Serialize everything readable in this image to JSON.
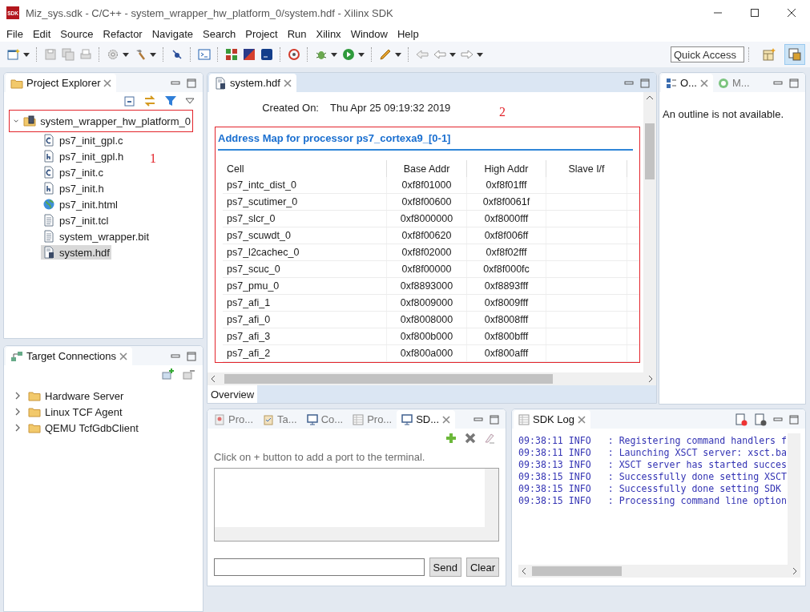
{
  "window": {
    "title": "Miz_sys.sdk - C/C++ - system_wrapper_hw_platform_0/system.hdf - Xilinx SDK",
    "app_icon_text": "SDK"
  },
  "menu": [
    "File",
    "Edit",
    "Source",
    "Refactor",
    "Navigate",
    "Search",
    "Project",
    "Run",
    "Xilinx",
    "Window",
    "Help"
  ],
  "quick_access": {
    "placeholder": "Quick Access"
  },
  "perspectives": [
    {
      "kind": "open",
      "selected": false
    },
    {
      "kind": "c",
      "selected": true
    }
  ],
  "project_explorer": {
    "tab": "Project Explorer",
    "annotation": "1",
    "tree": [
      {
        "label": "system_wrapper_hw_platform_0",
        "kind": "project",
        "expanded": true,
        "annotated": true,
        "selected": false,
        "children": [
          {
            "label": "ps7_init_gpl.c",
            "kind": "c",
            "selected": false
          },
          {
            "label": "ps7_init_gpl.h",
            "kind": "h",
            "selected": false
          },
          {
            "label": "ps7_init.c",
            "kind": "c",
            "selected": false
          },
          {
            "label": "ps7_init.h",
            "kind": "h",
            "selected": false
          },
          {
            "label": "ps7_init.html",
            "kind": "html",
            "selected": false
          },
          {
            "label": "ps7_init.tcl",
            "kind": "text",
            "selected": false
          },
          {
            "label": "system_wrapper.bit",
            "kind": "text",
            "selected": false
          },
          {
            "label": "system.hdf",
            "kind": "hdf",
            "selected": true
          }
        ]
      }
    ]
  },
  "target_connections": {
    "tab": "Target Connections",
    "tree": [
      {
        "label": "Hardware Server",
        "expanded": false
      },
      {
        "label": "Linux TCF Agent",
        "expanded": false
      },
      {
        "label": "QEMU TcfGdbClient",
        "expanded": false
      }
    ]
  },
  "editor": {
    "tab": "system.hdf",
    "created_on": {
      "label": "Created On:",
      "value": "Thu Apr 25 09:19:32 2019"
    },
    "annotation": "2",
    "address_map": {
      "title": "Address Map for processor ps7_cortexa9_[0-1]",
      "annotated": true,
      "columns": [
        "Cell",
        "Base Addr",
        "High Addr",
        "Slave I/f"
      ],
      "rows": [
        [
          "ps7_intc_dist_0",
          "0xf8f01000",
          "0xf8f01fff"
        ],
        [
          "ps7_scutimer_0",
          "0xf8f00600",
          "0xf8f0061f"
        ],
        [
          "ps7_slcr_0",
          "0xf8000000",
          "0xf8000fff"
        ],
        [
          "ps7_scuwdt_0",
          "0xf8f00620",
          "0xf8f006ff"
        ],
        [
          "ps7_l2cachec_0",
          "0xf8f02000",
          "0xf8f02fff"
        ],
        [
          "ps7_scuc_0",
          "0xf8f00000",
          "0xf8f000fc"
        ],
        [
          "ps7_pmu_0",
          "0xf8893000",
          "0xf8893fff"
        ],
        [
          "ps7_afi_1",
          "0xf8009000",
          "0xf8009fff"
        ],
        [
          "ps7_afi_0",
          "0xf8008000",
          "0xf8008fff"
        ],
        [
          "ps7_afi_3",
          "0xf800b000",
          "0xf800bfff"
        ],
        [
          "ps7_afi_2",
          "0xf800a000",
          "0xf800afff"
        ]
      ]
    },
    "page_tabs": [
      {
        "label": "Overview",
        "selected": true
      }
    ]
  },
  "outline": {
    "tabs": [
      {
        "label": "O...",
        "kind": "outline",
        "selected": true
      },
      {
        "label": "M...",
        "kind": "make",
        "selected": false
      }
    ],
    "message": "An outline is not available."
  },
  "terminal": {
    "tabs": [
      {
        "label": "Pro...",
        "kind": "problems",
        "selected": false
      },
      {
        "label": "Ta...",
        "kind": "tasks",
        "selected": false
      },
      {
        "label": "Co...",
        "kind": "console",
        "selected": false
      },
      {
        "label": "Pro...",
        "kind": "properties",
        "selected": false
      },
      {
        "label": "SD...",
        "kind": "console",
        "selected": true
      }
    ],
    "hint": "Click on + button to add a port to the terminal.",
    "buttons": [
      "Send",
      "Clear"
    ]
  },
  "sdk_log": {
    "tab": "SDK Log",
    "lines": [
      "09:38:11 INFO   : Registering command handlers f",
      "09:38:11 INFO   : Launching XSCT server: xsct.ba",
      "09:38:13 INFO   : XSCT server has started succes",
      "09:38:15 INFO   : Successfully done setting XSCT",
      "09:38:15 INFO   : Successfully done setting SDK",
      "09:38:15 INFO   : Processing command line option"
    ]
  }
}
